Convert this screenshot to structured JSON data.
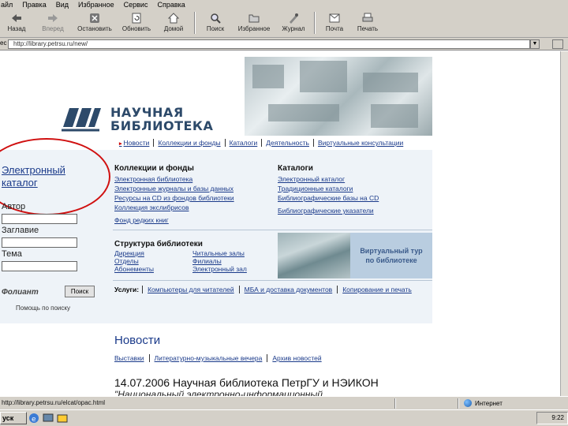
{
  "menu": [
    "айл",
    "Правка",
    "Вид",
    "Избранное",
    "Сервис",
    "Справка"
  ],
  "toolbar": {
    "back": "Назад",
    "forward": "Вперед",
    "stop": "Остановить",
    "refresh": "Обновить",
    "home": "Домой",
    "search": "Поиск",
    "favorites": "Избранное",
    "history": "Журнал",
    "mail": "Почта",
    "print": "Печать"
  },
  "address": {
    "label": "ес",
    "url": "http://library.petrsu.ru/new/"
  },
  "page": {
    "logo_line1": "НАУЧНАЯ",
    "logo_line2": "БИБЛИОТЕКА",
    "topnav": [
      "Новости",
      "Коллекции и фонды",
      "Каталоги",
      "Деятельность",
      "Виртуальные консультации"
    ],
    "catalog": {
      "title_line1": "Электронный",
      "title_line2": "каталог",
      "author_label": "Автор",
      "title_label": "Заглавие",
      "subject_label": "Тема",
      "engine_logo": "Фолиант",
      "search_button": "Поиск",
      "help_link": "Помощь по поиску"
    },
    "collections": {
      "title": "Коллекции и фонды",
      "links": [
        "Электронная библиотека",
        "Электронные журналы и базы данных",
        "Ресурсы на CD из фондов библиотеки",
        "Коллекция экслибрисов",
        "Фонд редких книг"
      ]
    },
    "catalogs": {
      "title": "Каталоги",
      "links": [
        "Электронный каталог",
        "Традиционные каталоги",
        "Библиографические базы на CD",
        "Библиографические указатели"
      ]
    },
    "structure": {
      "title": "Структура библиотеки",
      "col1": [
        "Дирекция",
        "Отделы",
        "Абонементы"
      ],
      "col2": [
        "Читальные залы",
        "Филиалы",
        "Электронный зал"
      ]
    },
    "tour": {
      "line1": "Виртуальный тур",
      "line2": "по библиотеке"
    },
    "services": {
      "label": "Услуги:",
      "items": [
        "Компьютеры для читателей",
        "МБА и доставка документов",
        "Копирование и печать"
      ]
    },
    "news": {
      "title": "Новости",
      "tabs": [
        "Выставки",
        "Литературно-музыкальные вечера",
        "Архив новостей"
      ],
      "headline": "14.07.2006 Научная библиотека ПетрГУ и НЭИКОН",
      "subline": "\"Национальный электронно-информационный"
    }
  },
  "statusbar": {
    "url": "http://library.petrsu.ru/elcat/opac.html",
    "zone": "Интернет"
  },
  "taskbar": {
    "start": "уск",
    "clock": "9:22"
  }
}
